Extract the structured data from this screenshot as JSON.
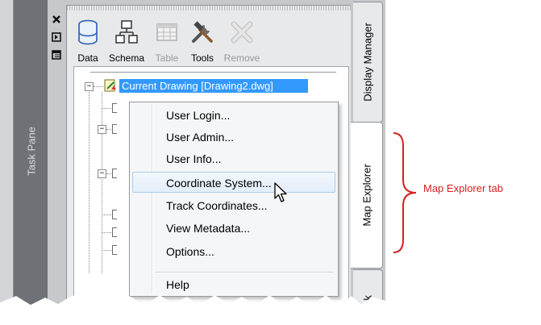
{
  "task_pane": {
    "label": "Task Pane"
  },
  "icon_strip": [
    {
      "name": "close-icon",
      "glyph": "✕"
    },
    {
      "name": "auto-hide-icon",
      "glyph": "◧"
    },
    {
      "name": "properties-icon",
      "glyph": "▤"
    }
  ],
  "toolbar": {
    "tools": [
      {
        "id": "data",
        "label": "Data",
        "icon": "database-icon",
        "enabled": true
      },
      {
        "id": "schema",
        "label": "Schema",
        "icon": "schema-icon",
        "enabled": true
      },
      {
        "id": "table",
        "label": "Table",
        "icon": "table-icon",
        "enabled": false
      },
      {
        "id": "tools",
        "label": "Tools",
        "icon": "wrench-hammer-icon",
        "enabled": true
      },
      {
        "id": "remove",
        "label": "Remove",
        "icon": "remove-icon",
        "enabled": false
      }
    ]
  },
  "tree": {
    "root_label": "Current Drawing [Drawing2.dwg]"
  },
  "context_menu": {
    "items": [
      {
        "label": "User Login..."
      },
      {
        "label": "User Admin..."
      },
      {
        "label": "User Info..."
      },
      {
        "label": "Coordinate System...",
        "highlighted": true
      },
      {
        "label": "Track Coordinates..."
      },
      {
        "label": "View Metadata..."
      },
      {
        "label": "Options..."
      },
      {
        "label": "Help"
      }
    ]
  },
  "side_tabs": [
    {
      "label": "Display Manager",
      "active": false
    },
    {
      "label": "Map Explorer",
      "active": true
    },
    {
      "label": "ok",
      "active": false
    }
  ],
  "callout": {
    "text": "Map Explorer tab",
    "color": "#d62020"
  },
  "colors": {
    "selection": "#3399ff",
    "task_pane": "#6e7276"
  }
}
